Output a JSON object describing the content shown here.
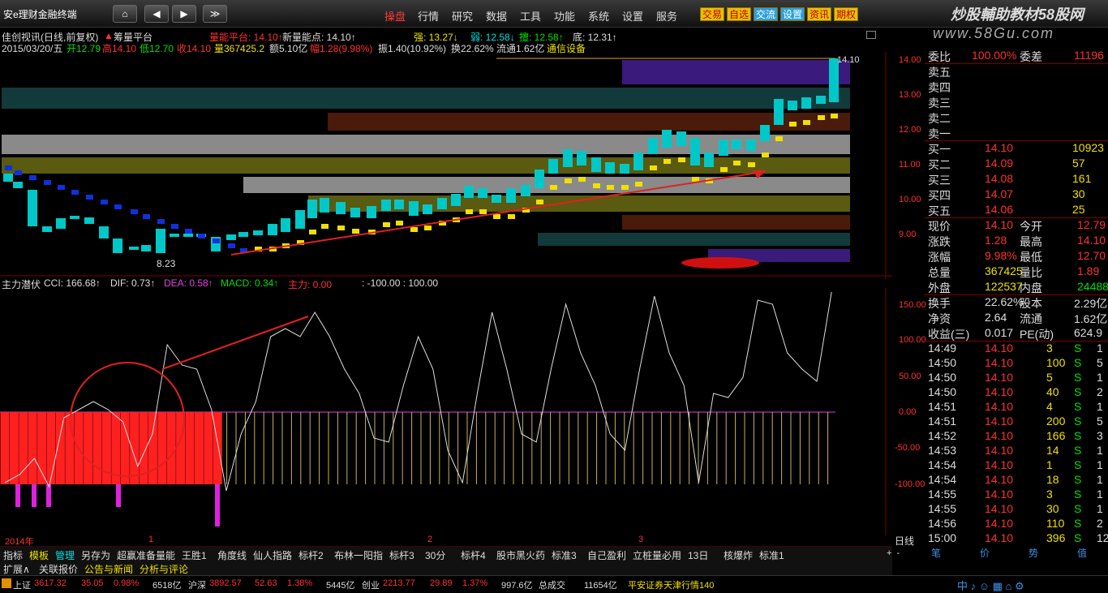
{
  "app": {
    "title": "安e理财金融终端"
  },
  "nav": {
    "home": "⌂",
    "prev": "◀",
    "next": "▶",
    "down": "≫",
    "menus": [
      "操盘",
      "行情",
      "研究",
      "数据",
      "工具",
      "功能",
      "系统",
      "设置",
      "服务"
    ],
    "buttons": [
      "交易",
      "自选",
      "交流",
      "设置",
      "资讯",
      "期权"
    ]
  },
  "brand": {
    "line1": "炒股輔助教材58股网",
    "line2": "www.58Gu.com"
  },
  "header": {
    "stock": "佳创视讯(日线,前复权)",
    "indicator": "筹量平台",
    "l1_a": "量能平台: 14.10↑",
    "l1_b": "新量能点: 14.10↑",
    "l1_c": "强: 13.27↓",
    "l1_d": "弱: 12.58↓",
    "l1_e": "擅: 12.58↑",
    "l1_f": "底: 12.31↑",
    "l2_date": "2015/03/20/五",
    "l2_open": "开12.79",
    "l2_high": "高14.10",
    "l2_low": "低12.70",
    "l2_close": "收14.10",
    "l2_vol": "量367425.2",
    "l2_amt": "额5.10亿",
    "l2_pct": "幅1.28(9.98%)",
    "l2_amp": "振1.40(10.92%)",
    "l2_turn": "换22.62%",
    "l2_float": "流通1.62亿",
    "l2_sector": "通信设备"
  },
  "price_axis": [
    "14.00",
    "13.00",
    "12.00",
    "11.00",
    "10.00",
    "9.00"
  ],
  "low_label": "8.23",
  "high_label": "14.10",
  "sub": {
    "name": "主力潜伏",
    "cci": "CCI: 166.68↑",
    "dif": "DIF: 0.73↑",
    "dea": "DEA: 0.58↑",
    "macd": "MACD: 0.34↑",
    "main": "主力: 0.00",
    "ref": ": -100.00 : 100.00",
    "axis": [
      "150.00",
      "100.00",
      "50.00",
      "0.00",
      "-50.00",
      "-100.00"
    ]
  },
  "date_axis": {
    "start": "2014年",
    "m1": "1",
    "m2": "2",
    "m3": "3",
    "mode": "日线"
  },
  "right_panel": {
    "weibi_label": "委比",
    "weibi": "100.00%",
    "weicha_label": "委差",
    "weicha": "11196",
    "sells": [
      "卖五",
      "卖四",
      "卖三",
      "卖二",
      "卖一"
    ],
    "buys": [
      {
        "label": "买一",
        "price": "14.10",
        "vol": "10923"
      },
      {
        "label": "买二",
        "price": "14.09",
        "vol": "57"
      },
      {
        "label": "买三",
        "price": "14.08",
        "vol": "161"
      },
      {
        "label": "买四",
        "price": "14.07",
        "vol": "30"
      },
      {
        "label": "买五",
        "price": "14.06",
        "vol": "25"
      }
    ],
    "stats": [
      {
        "k1": "现价",
        "v1": "14.10",
        "k2": "今开",
        "v2": "12.79"
      },
      {
        "k1": "涨跌",
        "v1": "1.28",
        "k2": "最高",
        "v2": "14.10"
      },
      {
        "k1": "涨幅",
        "v1": "9.98%",
        "k2": "最低",
        "v2": "12.70"
      },
      {
        "k1": "总量",
        "v1": "367425",
        "k2": "量比",
        "v2": "1.89"
      },
      {
        "k1": "外盘",
        "v1": "122537",
        "k2": "内盘",
        "v2": "244888"
      }
    ],
    "stats2": [
      {
        "k1": "换手",
        "v1": "22.62%",
        "k2": "股本",
        "v2": "2.29亿"
      },
      {
        "k1": "净资",
        "v1": "2.64",
        "k2": "流通",
        "v2": "1.62亿"
      },
      {
        "k1": "收益(三)",
        "v1": "0.017",
        "k2": "PE(动)",
        "v2": "624.9"
      }
    ],
    "ticks": [
      {
        "t": "14:49",
        "p": "14.10",
        "v": "3",
        "s": "S",
        "n": "1"
      },
      {
        "t": "14:50",
        "p": "14.10",
        "v": "100",
        "s": "S",
        "n": "5"
      },
      {
        "t": "14:50",
        "p": "14.10",
        "v": "5",
        "s": "S",
        "n": "1"
      },
      {
        "t": "14:50",
        "p": "14.10",
        "v": "40",
        "s": "S",
        "n": "2"
      },
      {
        "t": "14:51",
        "p": "14.10",
        "v": "4",
        "s": "S",
        "n": "1"
      },
      {
        "t": "14:51",
        "p": "14.10",
        "v": "200",
        "s": "S",
        "n": "5"
      },
      {
        "t": "14:52",
        "p": "14.10",
        "v": "166",
        "s": "S",
        "n": "3"
      },
      {
        "t": "14:53",
        "p": "14.10",
        "v": "14",
        "s": "S",
        "n": "1"
      },
      {
        "t": "14:54",
        "p": "14.10",
        "v": "1",
        "s": "S",
        "n": "1"
      },
      {
        "t": "14:54",
        "p": "14.10",
        "v": "18",
        "s": "S",
        "n": "1"
      },
      {
        "t": "14:55",
        "p": "14.10",
        "v": "3",
        "s": "S",
        "n": "1"
      },
      {
        "t": "14:55",
        "p": "14.10",
        "v": "30",
        "s": "S",
        "n": "1"
      },
      {
        "t": "14:56",
        "p": "14.10",
        "v": "110",
        "s": "S",
        "n": "2"
      },
      {
        "t": "15:00",
        "p": "14.10",
        "v": "396",
        "s": "S",
        "n": "12"
      }
    ],
    "bottom": [
      "笔",
      "价",
      "势",
      "值"
    ]
  },
  "tabs": [
    "指标",
    "模板",
    "管理",
    "另存为",
    "超赢准备量能",
    "王胜1",
    "角度线",
    "仙人指路",
    "标杆2",
    "布林一阳指",
    "标杆3",
    "30分",
    "标杆4",
    "股市黑火药",
    "标准3",
    "自己盈利",
    "立桩量必用",
    "13日",
    "核爆炸",
    "标准1"
  ],
  "tabs2": [
    "扩展∧",
    "关联报价",
    "公告与新闻",
    "分析与评论"
  ],
  "status": {
    "sh_label": "上证",
    "sh": "3617.32",
    "sh_chg": "35.05",
    "sh_pct": "0.98%",
    "sh_amt": "6518亿",
    "hs_label": "沪深",
    "hs": "3892.57",
    "hs_chg": "52.63",
    "hs_pct": "1.38%",
    "hs_amt": "5445亿",
    "cy_label": "创业",
    "cy": "2213.77",
    "cy_chg": "29.89",
    "cy_pct": "1.37%",
    "cy_amt": "997.6亿",
    "total_label": "总成交",
    "total": "11654亿",
    "broker": "平安证券天津行情140"
  }
}
